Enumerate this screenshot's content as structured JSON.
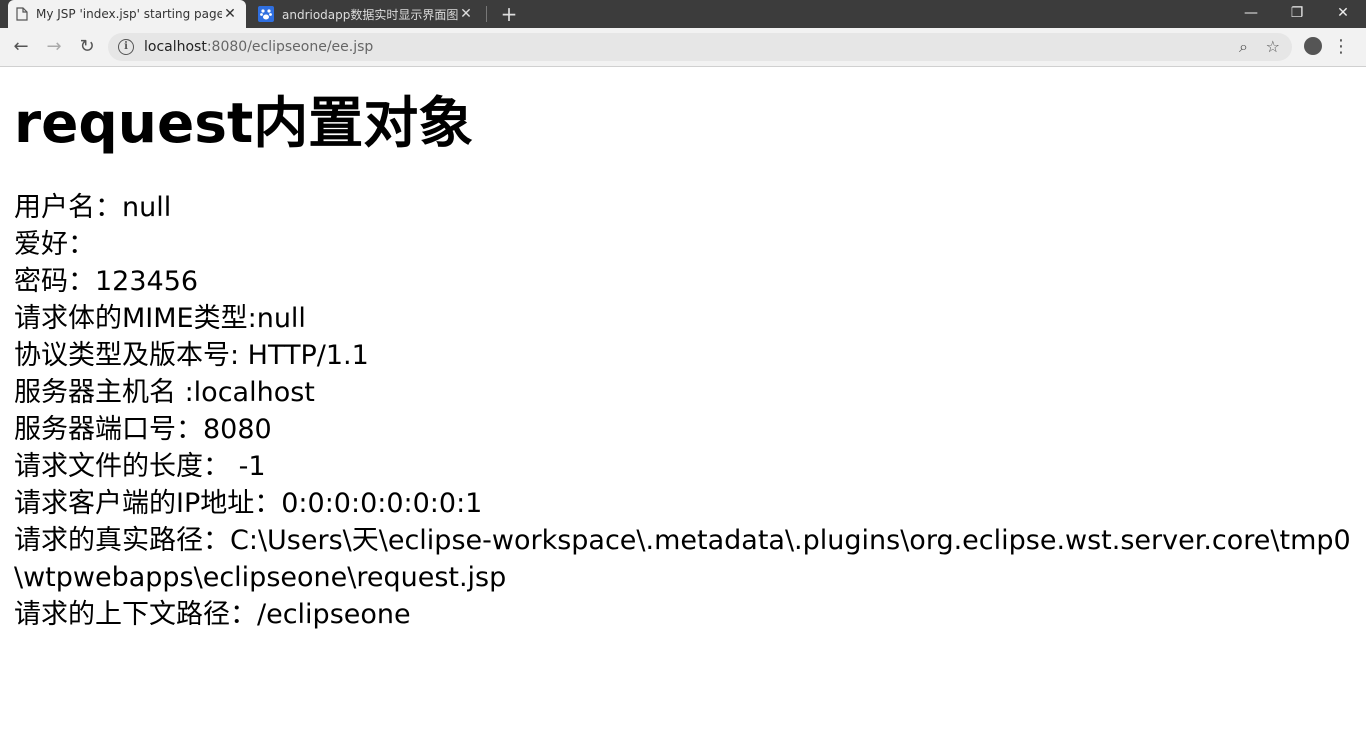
{
  "browser": {
    "tabs": [
      {
        "title": "My JSP 'index.jsp' starting page",
        "icon": "document-icon"
      },
      {
        "title": "andriodapp数据实时显示界面图",
        "icon": "baidu-paw-icon"
      }
    ],
    "url_host": "localhost",
    "url_rest": ":8080/eclipseone/ee.jsp"
  },
  "page": {
    "heading": "request内置对象",
    "lines": [
      "用户名：null",
      "爱好：",
      "密码：123456",
      "请求体的MIME类型:null",
      "协议类型及版本号: HTTP/1.1",
      "服务器主机名 :localhost",
      "服务器端口号：8080",
      "请求文件的长度： -1",
      "请求客户端的IP地址：0:0:0:0:0:0:0:1",
      "请求的真实路径：C:\\Users\\天\\eclipse-workspace\\.metadata\\.plugins\\org.eclipse.wst.server.core\\tmp0\\wtpwebapps\\eclipseone\\request.jsp",
      "请求的上下文路径：/eclipseone"
    ]
  }
}
